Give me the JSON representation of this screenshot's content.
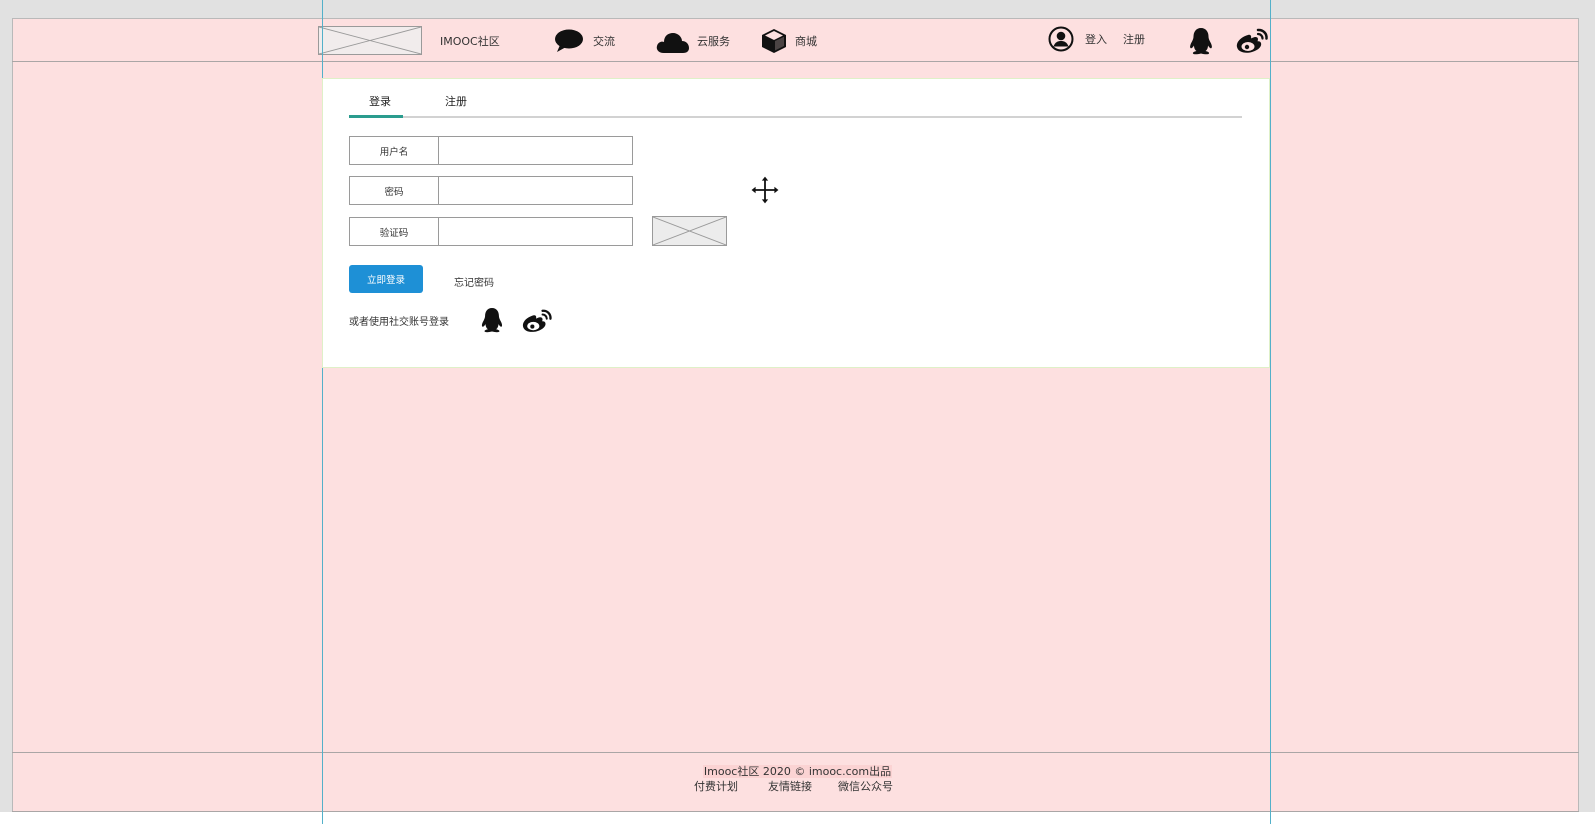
{
  "header": {
    "brand": "IMOOC社区",
    "nav": [
      {
        "label": "交流",
        "icon": "chat-bubble-icon"
      },
      {
        "label": "云服务",
        "icon": "cloud-icon"
      },
      {
        "label": "商城",
        "icon": "box-icon"
      }
    ],
    "login": "登入",
    "register": "注册",
    "social_icons": [
      "qq-icon",
      "weibo-icon"
    ]
  },
  "tabs": [
    {
      "label": "登录",
      "active": true
    },
    {
      "label": "注册",
      "active": false
    }
  ],
  "form": {
    "username_label": "用户名",
    "password_label": "密码",
    "captcha_label": "验证码",
    "submit_label": "立即登录",
    "forgot_label": "忘记密码",
    "social_label": "或者使用社交账号登录"
  },
  "footer": {
    "copyright": "Imooc社区 2020 © imooc.com出品",
    "links": [
      "付费计划",
      "友情链接",
      "微信公众号"
    ]
  },
  "colors": {
    "background": "#fde0e0",
    "primary_button": "#1e90d6",
    "tab_active": "#2a9c8e",
    "guide": "#53b0c9"
  }
}
